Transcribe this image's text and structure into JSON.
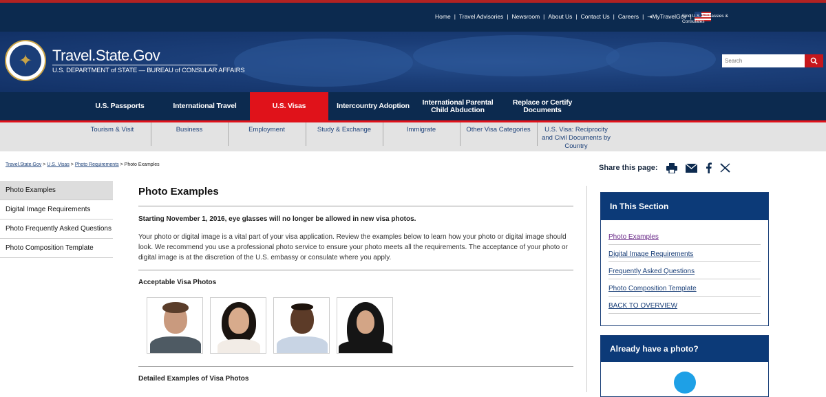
{
  "utility": {
    "links": [
      "Home",
      "Travel Advisories",
      "Newsroom",
      "About Us",
      "Contact Us",
      "Careers",
      "MyTravelGov"
    ],
    "embassies": "Find U.S. Embassies & Consulates"
  },
  "brand": {
    "title": "Travel.State.Gov",
    "subtitle": "U.S. DEPARTMENT of STATE — BUREAU of CONSULAR AFFAIRS"
  },
  "search": {
    "placeholder": "Search"
  },
  "mainnav": [
    "U.S. Passports",
    "International Travel",
    "U.S. Visas",
    "Intercountry Adoption",
    "International Parental Child Abduction",
    "Replace or Certify Documents"
  ],
  "subnav": [
    "Tourism & Visit",
    "Business",
    "Employment",
    "Study & Exchange",
    "Immigrate",
    "Other Visa Categories",
    "U.S. Visa: Reciprocity and Civil Documents by Country"
  ],
  "breadcrumb": {
    "items": [
      "Travel.State.Gov",
      "U.S. Visas",
      "Photo Requirements"
    ],
    "current": "Photo Examples",
    "separator": ">"
  },
  "share": {
    "label": "Share this page:"
  },
  "leftnav": [
    "Photo Examples",
    "Digital Image Requirements",
    "Photo Frequently Asked Questions",
    "Photo Composition Template"
  ],
  "content": {
    "title": "Photo Examples",
    "notice": "Starting November 1, 2016, eye glasses will no longer be allowed in new visa photos.",
    "intro": "Your photo or digital image is a vital part of your visa application. Review the examples below to learn how your photo or digital image should look. We recommend you use a professional photo service to ensure your photo meets all the requirements. The acceptance of your photo or digital image is at the discretion of the U.S. embassy or consulate where you apply.",
    "acceptable_heading": "Acceptable Visa Photos",
    "detailed_heading": "Detailed Examples of Visa Photos"
  },
  "section": {
    "heading": "In This Section",
    "links": [
      "Photo Examples",
      "Digital Image Requirements",
      "Frequently Asked Questions",
      "Photo Composition Template",
      "BACK TO OVERVIEW"
    ]
  },
  "box2": {
    "heading": "Already have a photo?"
  },
  "colors": {
    "navy": "#0c2a4f",
    "red": "#e0121a",
    "link": "#1a3f78"
  }
}
